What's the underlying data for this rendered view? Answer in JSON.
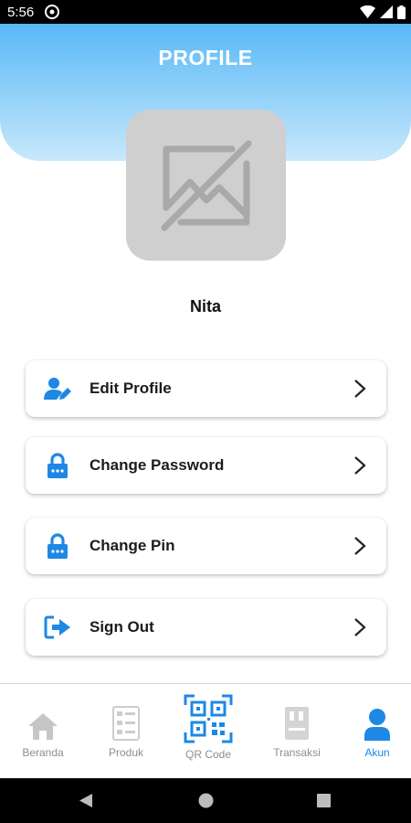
{
  "status_bar": {
    "time": "5:56"
  },
  "header": {
    "title": "PROFILE"
  },
  "profile": {
    "name": "Nita"
  },
  "menu": [
    {
      "label": "Edit Profile",
      "icon": "edit-user-icon"
    },
    {
      "label": "Change Password",
      "icon": "lock-icon"
    },
    {
      "label": "Change Pin",
      "icon": "lock-icon"
    },
    {
      "label": "Sign Out",
      "icon": "sign-out-icon"
    }
  ],
  "bottom_nav": [
    {
      "label": "Beranda",
      "icon": "home-icon",
      "active": false
    },
    {
      "label": "Produk",
      "icon": "product-list-icon",
      "active": false
    },
    {
      "label": "QR Code",
      "icon": "qr-code-icon",
      "active": false
    },
    {
      "label": "Transaksi",
      "icon": "transaction-icon",
      "active": false
    },
    {
      "label": "Akun",
      "icon": "account-icon",
      "active": true
    }
  ],
  "colors": {
    "accent": "#1e88e5",
    "header_top": "#58b8f7",
    "inactive": "#8e8e8e"
  }
}
